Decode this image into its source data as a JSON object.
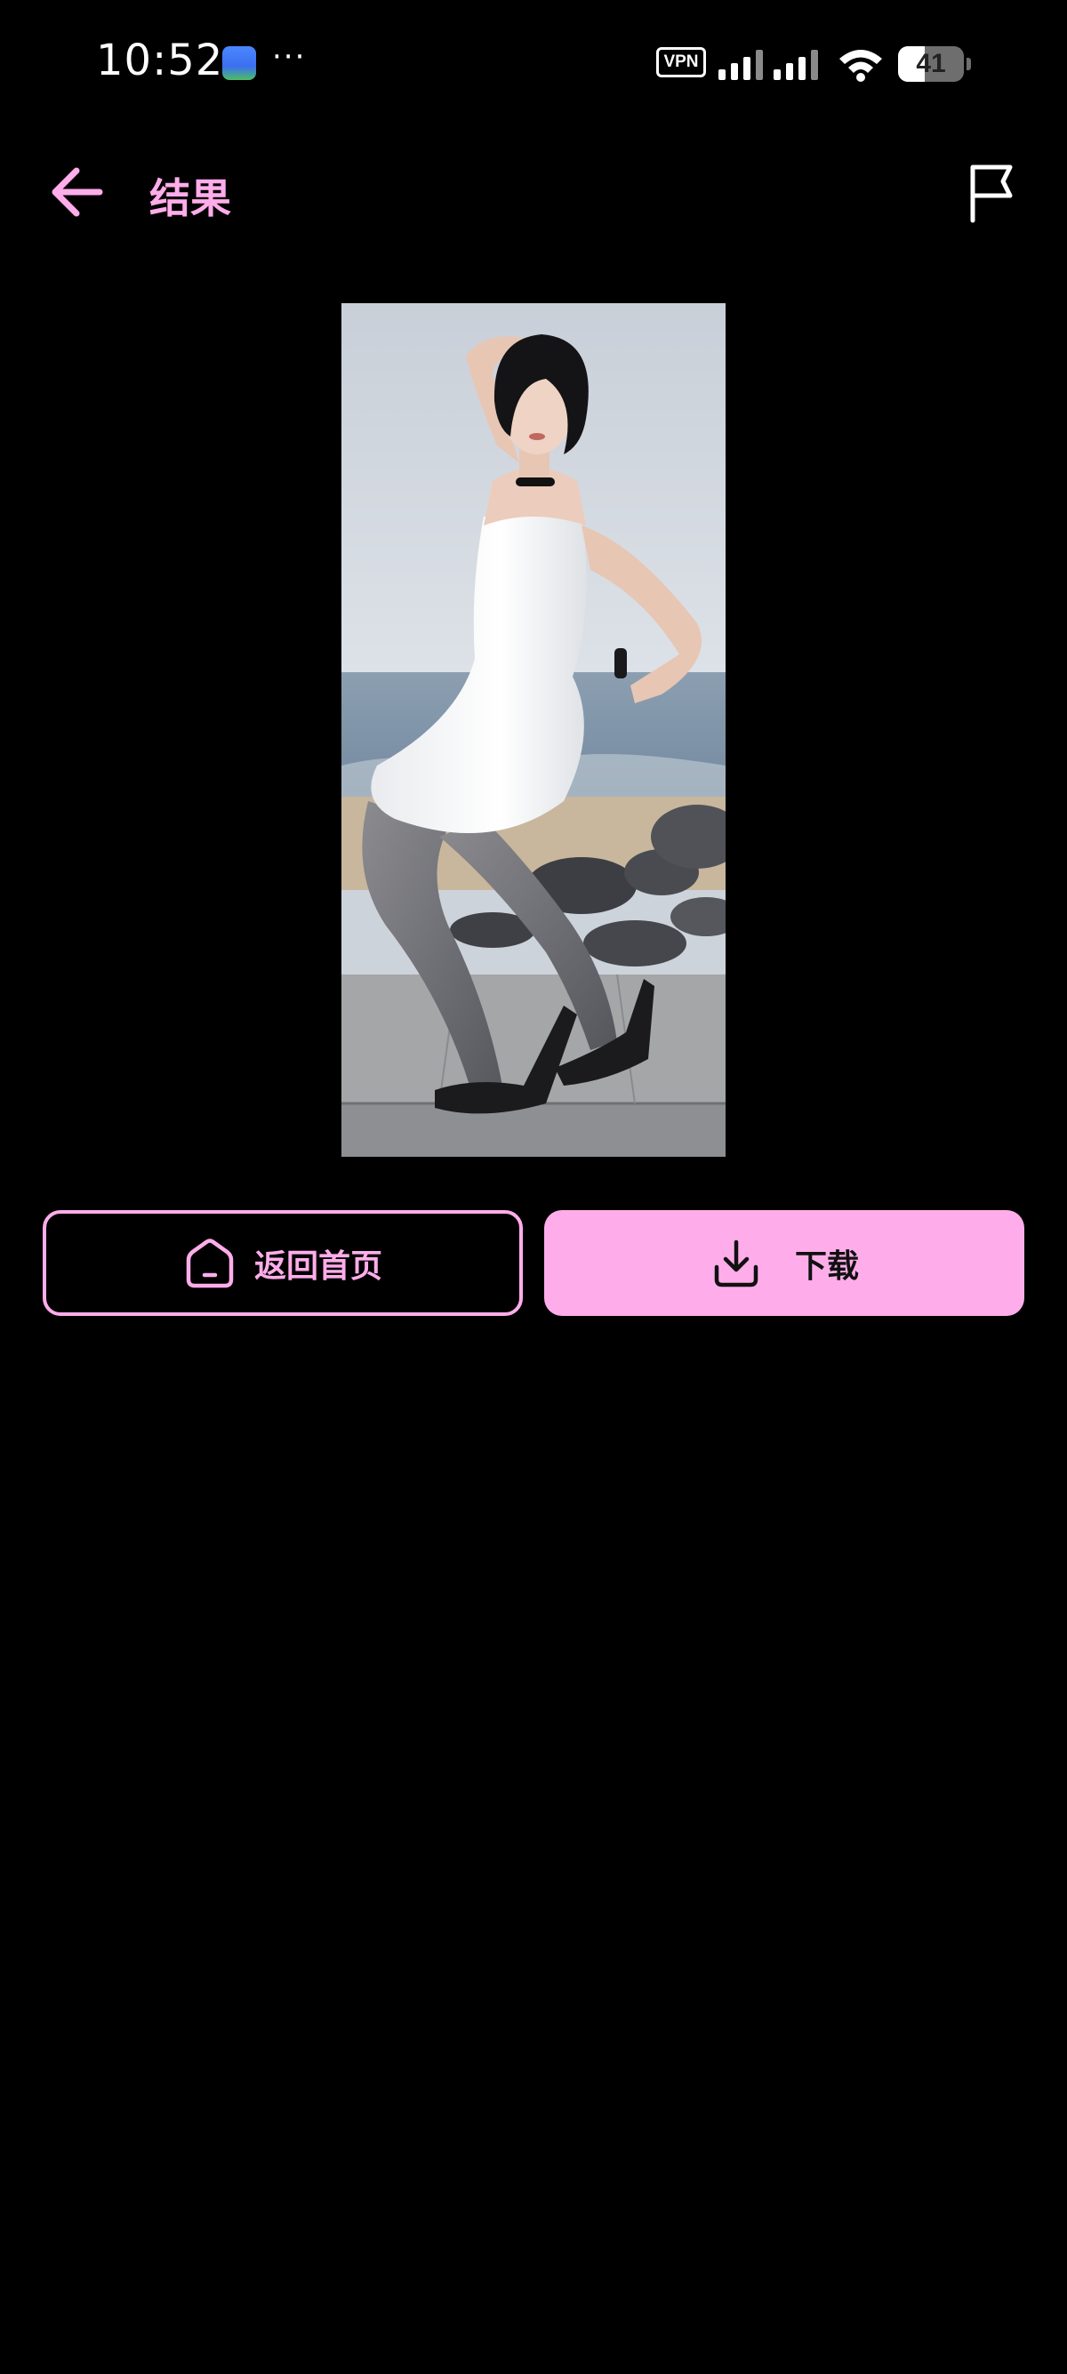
{
  "status_bar": {
    "time": "10:52",
    "more": "···",
    "vpn_label": "VPN",
    "battery_level": "41",
    "battery_fraction": 0.41
  },
  "app_bar": {
    "title": "结果",
    "back_icon": "arrow-left-icon",
    "report_icon": "flag-icon"
  },
  "result": {
    "image_icon": "photo-woman-white-dress-beach"
  },
  "actions": {
    "home_label": "返回首页",
    "home_icon": "home-icon",
    "download_label": "下载",
    "download_icon": "download-icon"
  },
  "colors": {
    "accent": "#ffadea",
    "background": "#000000"
  }
}
